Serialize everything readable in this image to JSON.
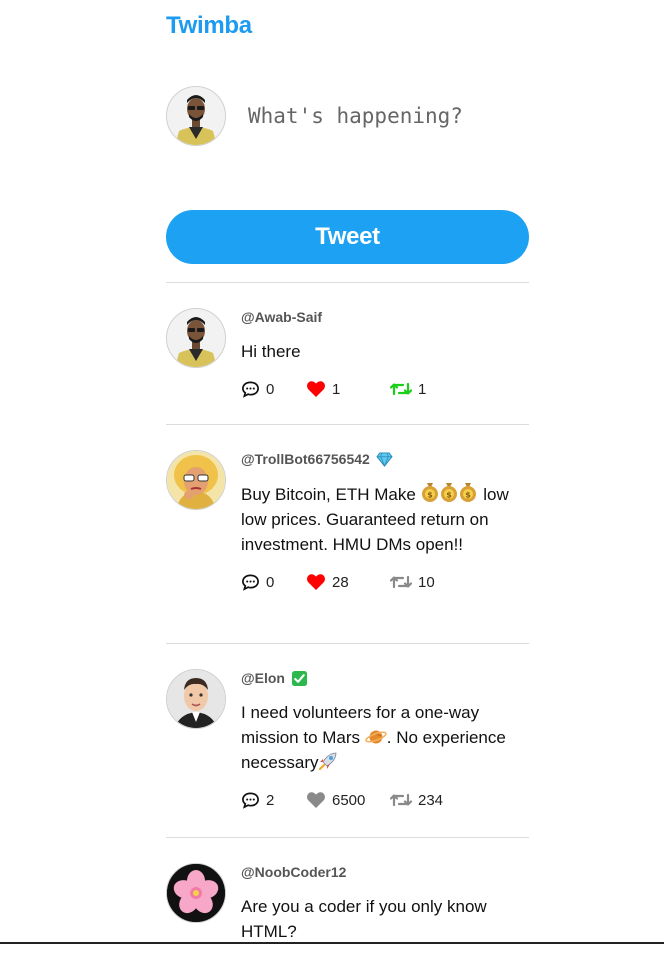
{
  "app": {
    "brand": "Twimba"
  },
  "compose": {
    "placeholder": "What's happening?",
    "tweet_label": "Tweet"
  },
  "colors": {
    "accent": "#1da1f2",
    "liked": "#ff0000",
    "retweeted": "#19cf19",
    "neutral": "#8a8a8a"
  },
  "posts": [
    {
      "handle": "@Awab-Saif",
      "badge": "",
      "text": "Hi there",
      "replies": "0",
      "likes": "1",
      "retweets": "1",
      "liked": true,
      "retweeted": true
    },
    {
      "handle": "@TrollBot66756542",
      "badge": "diamond",
      "text": "Buy Bitcoin, ETH Make",
      "text2": "low low prices. Guaranteed return on investment. HMU DMs open!!",
      "replies": "0",
      "likes": "28",
      "retweets": "10",
      "liked": true,
      "retweeted": false
    },
    {
      "handle": "@Elon",
      "badge": "check",
      "text": "I need volunteers for a one-way mission to Mars",
      "text2": ". No experience necessary",
      "replies": "2",
      "likes": "6500",
      "retweets": "234",
      "liked": false,
      "retweeted": false
    },
    {
      "handle": "@NoobCoder12",
      "badge": "",
      "text": "Are you a coder if you only know HTML?"
    }
  ]
}
